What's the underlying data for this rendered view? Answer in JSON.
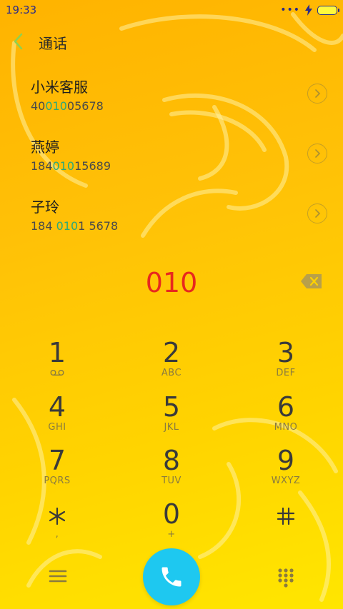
{
  "status_bar": {
    "time": "19:33",
    "dots": "•••"
  },
  "header": {
    "title": "通话"
  },
  "contacts": [
    {
      "name": "小米客服",
      "number_pre": "40",
      "number_match": "010",
      "number_post": "05678"
    },
    {
      "name": "燕婷",
      "number_pre": "184",
      "number_match": "010",
      "number_post": "15689"
    },
    {
      "name": "子玲",
      "number_pre": "184 ",
      "number_match": "010",
      "number_post": "1 5678"
    }
  ],
  "dialer": {
    "dialed_number": "010"
  },
  "keypad": [
    {
      "digit": "1",
      "letters": ""
    },
    {
      "digit": "2",
      "letters": "ABC"
    },
    {
      "digit": "3",
      "letters": "DEF"
    },
    {
      "digit": "4",
      "letters": "GHI"
    },
    {
      "digit": "5",
      "letters": "JKL"
    },
    {
      "digit": "6",
      "letters": "MNO"
    },
    {
      "digit": "7",
      "letters": "PQRS"
    },
    {
      "digit": "8",
      "letters": "TUV"
    },
    {
      "digit": "9",
      "letters": "WXYZ"
    },
    {
      "digit": "*",
      "letters": ","
    },
    {
      "digit": "0",
      "letters": "+"
    },
    {
      "digit": "#",
      "letters": ""
    }
  ],
  "icons": {
    "back": "chevron-left-icon",
    "detail": "chevron-right-circle-icon",
    "backspace": "backspace-icon",
    "voicemail": "voicemail-icon",
    "menu": "menu-icon",
    "call": "phone-icon",
    "dialpad": "dialpad-icon",
    "battery": "battery-icon",
    "charging": "lightning-icon"
  },
  "colors": {
    "accent_call": "#1ec8f0",
    "dialed_text": "#e8281e",
    "match_highlight": "#2aa87a",
    "back_chevron": "#8fd14f"
  }
}
